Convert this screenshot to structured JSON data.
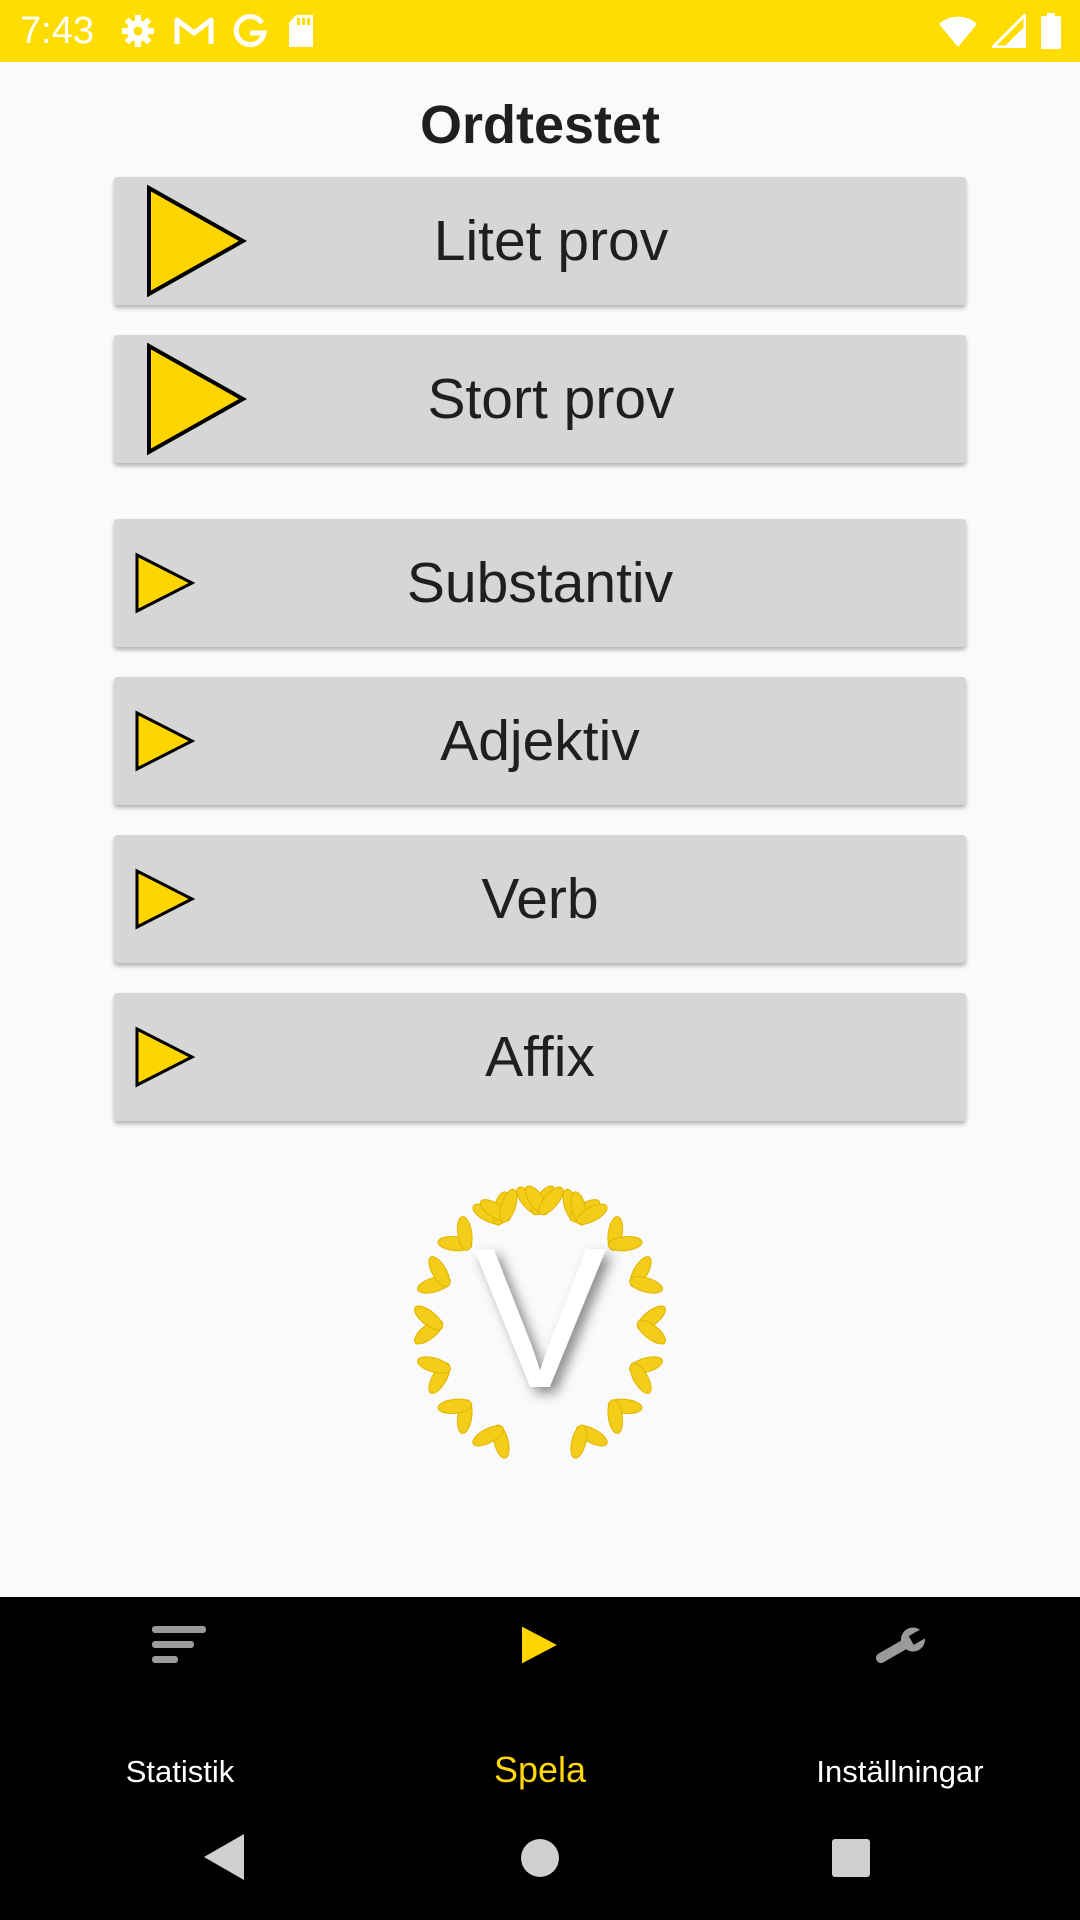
{
  "status_bar": {
    "time": "7:43",
    "left_icons": [
      "gear-icon",
      "gmail-icon",
      "google-icon",
      "sd-card-icon"
    ],
    "right_icons": [
      "wifi-icon",
      "signal-icon",
      "battery-icon"
    ],
    "background": "#ffdd00"
  },
  "page": {
    "title": "Ordtestet"
  },
  "buttons": [
    {
      "label": "Litet prov",
      "icon": "play-icon"
    },
    {
      "label": "Stort prov",
      "icon": "play-icon"
    },
    {
      "label": "Substantiv",
      "icon": "play-icon"
    },
    {
      "label": "Adjektiv",
      "icon": "play-icon"
    },
    {
      "label": "Verb",
      "icon": "play-icon"
    },
    {
      "label": "Affix",
      "icon": "play-icon"
    }
  ],
  "emblem": {
    "letter": "V",
    "icon": "laurel-wreath-icon"
  },
  "bottom_nav": {
    "items": [
      {
        "label": "Statistik",
        "icon": "sort-icon"
      },
      {
        "label": "Spela",
        "icon": "play-icon",
        "active": true
      },
      {
        "label": "Inställningar",
        "icon": "wrench-icon"
      }
    ],
    "active_color": "#ffd60a"
  },
  "system_nav": {
    "icons": [
      "back-icon",
      "home-icon",
      "recents-icon"
    ]
  },
  "colors": {
    "accent": "#ffd700",
    "button_bg": "#d6d6d6"
  }
}
